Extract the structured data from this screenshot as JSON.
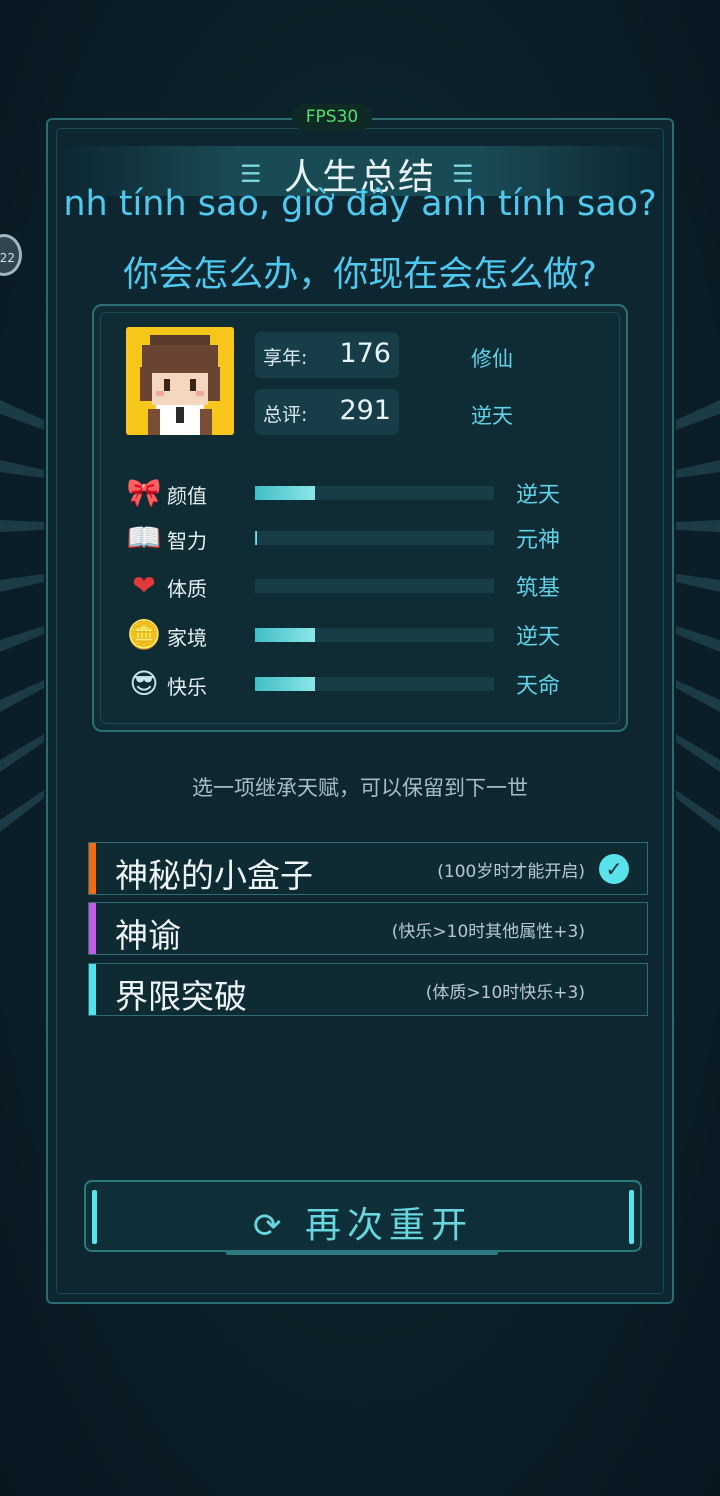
{
  "overlay": {
    "fps": "FPS30",
    "bubble_text": "22",
    "subtitle_line1": "nh tính sao, giờ đây anh tính sao?",
    "subtitle_line2": "你会怎么办，你现在会怎么做?"
  },
  "summary": {
    "title": "人生总结",
    "stats": [
      {
        "label": "享年:",
        "value": "176",
        "grade": "修仙"
      },
      {
        "label": "总评:",
        "value": "291",
        "grade": "逆天"
      }
    ],
    "attributes": [
      {
        "icon": "bow-icon",
        "glyph": "🎀",
        "name": "颜值",
        "fill_fraction": 0.25,
        "grade": "逆天"
      },
      {
        "icon": "book-icon",
        "glyph": "📖",
        "name": "智力",
        "fill_fraction": 0.01,
        "grade": "元神"
      },
      {
        "icon": "heart-icon",
        "glyph": "❤",
        "name": "体质",
        "fill_fraction": 0.0,
        "grade": "筑基"
      },
      {
        "icon": "coin-icon",
        "glyph": "🪙",
        "name": "家境",
        "fill_fraction": 0.25,
        "grade": "逆天"
      },
      {
        "icon": "sunglasses-face-icon",
        "glyph": "😎",
        "name": "快乐",
        "fill_fraction": 0.25,
        "grade": "天命"
      }
    ]
  },
  "inherit": {
    "hint": "选一项继承天赋，可以保留到下一世",
    "talents": [
      {
        "name": "神秘的小盒子",
        "desc": "(100岁时才能开启)",
        "color": "#f06a12",
        "selected": true
      },
      {
        "name": "神谕",
        "desc": "(快乐>10时其他属性+3)",
        "color": "#c35be8",
        "selected": false
      },
      {
        "name": "界限突破",
        "desc": "(体质>10时快乐+3)",
        "color": "#4fe2ea",
        "selected": false
      }
    ]
  },
  "restart_button": {
    "label": "再次重开",
    "icon": "refresh-icon"
  }
}
